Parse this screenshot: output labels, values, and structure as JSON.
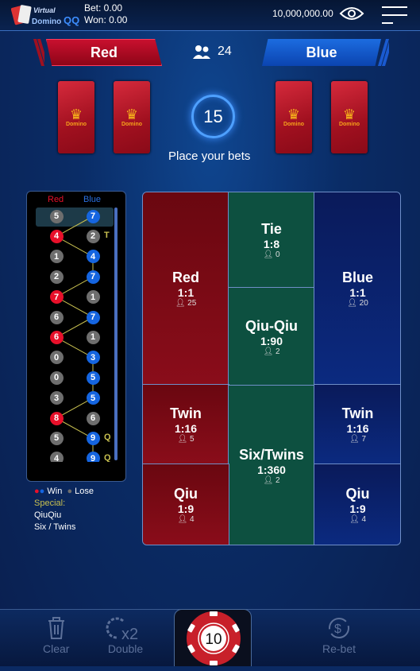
{
  "header": {
    "logo_text": "Virtual Domino QQ",
    "bet": "Bet: 0.00",
    "won": "Won: 0.00",
    "balance": "10,000,000.00"
  },
  "teams": {
    "red": "Red",
    "blue": "Blue",
    "players": "24"
  },
  "timer": {
    "seconds": "15",
    "status": "Place your bets"
  },
  "cards": {
    "label": "Domino"
  },
  "history": {
    "red_header": "Red",
    "blue_header": "Blue",
    "rows": [
      {
        "red": "5",
        "blue": "7",
        "win": "blue",
        "mark": ""
      },
      {
        "red": "4",
        "blue": "2",
        "win": "red",
        "mark": "T"
      },
      {
        "red": "1",
        "blue": "4",
        "win": "blue",
        "mark": ""
      },
      {
        "red": "2",
        "blue": "7",
        "win": "blue",
        "mark": ""
      },
      {
        "red": "7",
        "blue": "1",
        "win": "red",
        "mark": ""
      },
      {
        "red": "6",
        "blue": "7",
        "win": "blue",
        "mark": ""
      },
      {
        "red": "6",
        "blue": "1",
        "win": "red",
        "mark": ""
      },
      {
        "red": "0",
        "blue": "3",
        "win": "blue",
        "mark": ""
      },
      {
        "red": "0",
        "blue": "5",
        "win": "blue",
        "mark": ""
      },
      {
        "red": "3",
        "blue": "5",
        "win": "blue",
        "mark": ""
      },
      {
        "red": "8",
        "blue": "6",
        "win": "red",
        "mark": ""
      },
      {
        "red": "5",
        "blue": "9",
        "win": "blue",
        "mark": "Q"
      },
      {
        "red": "4",
        "blue": "9",
        "win": "blue",
        "mark": "Q"
      }
    ],
    "legend": {
      "win": "Win",
      "lose": "Lose",
      "special": "Special:",
      "items": [
        "QiuQiu",
        "Six / Twins"
      ]
    },
    "colors": {
      "red": "#e8102a",
      "blue": "#1565e0",
      "lose": "#6e6e6e",
      "marker": "#c8c050"
    }
  },
  "bets": [
    {
      "id": "red",
      "name": "Red",
      "odds": "1:1",
      "count": "25"
    },
    {
      "id": "tie",
      "name": "Tie",
      "odds": "1:8",
      "count": "0"
    },
    {
      "id": "qiuqiu",
      "name": "Qiu-Qiu",
      "odds": "1:90",
      "count": "2"
    },
    {
      "id": "blue",
      "name": "Blue",
      "odds": "1:1",
      "count": "20"
    },
    {
      "id": "red-twin",
      "name": "Twin",
      "odds": "1:16",
      "count": "5"
    },
    {
      "id": "six-twins",
      "name": "Six/Twins",
      "odds": "1:360",
      "count": "2"
    },
    {
      "id": "blue-twin",
      "name": "Twin",
      "odds": "1:16",
      "count": "7"
    },
    {
      "id": "red-qiu",
      "name": "Qiu",
      "odds": "1:9",
      "count": "4"
    },
    {
      "id": "blue-qiu",
      "name": "Qiu",
      "odds": "1:9",
      "count": "4"
    }
  ],
  "toolbar": {
    "clear": "Clear",
    "double": "Double",
    "chip": "10",
    "rebet": "Re-bet"
  }
}
